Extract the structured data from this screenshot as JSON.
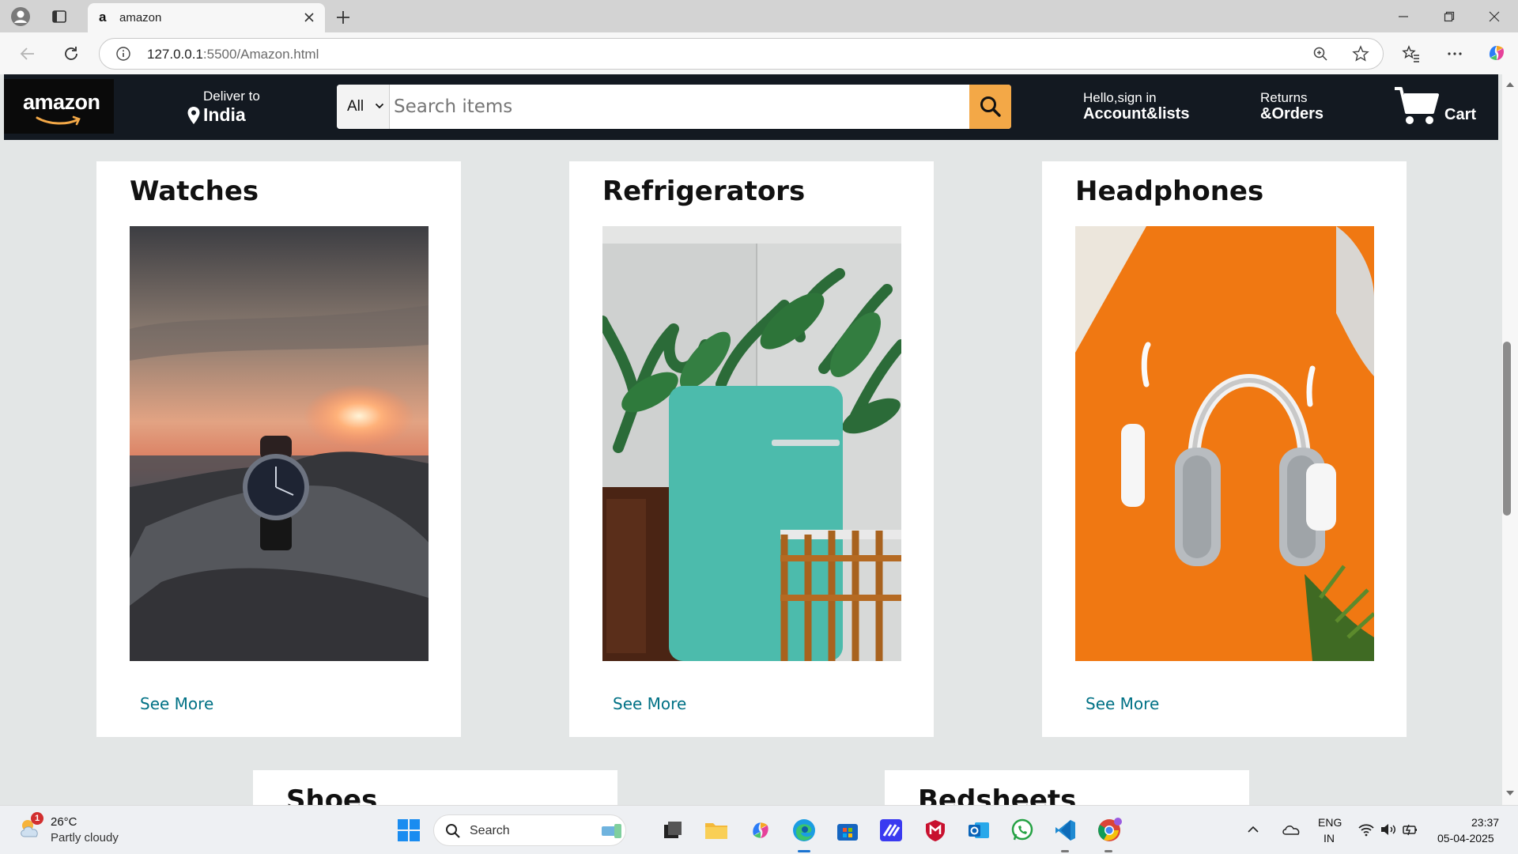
{
  "browser": {
    "tab_title": "amazon",
    "tab_favicon": "a",
    "url_host": "127.0.0.1",
    "url_rest": ":5500/Amazon.html"
  },
  "nav": {
    "logo": "amazon",
    "deliver_line1": "Deliver to",
    "deliver_line2": "India",
    "search_category": "All",
    "search_placeholder": "Search items",
    "account_line1": "Hello,sign in",
    "account_line2": "Account&lists",
    "returns_line1": "Returns",
    "returns_line2": "&Orders",
    "cart_label": "Cart"
  },
  "products": [
    {
      "title": "Watches",
      "link": "See More"
    },
    {
      "title": "Refrigerators",
      "link": "See More"
    },
    {
      "title": "Headphones",
      "link": "See More"
    },
    {
      "title": "Shoes"
    },
    {
      "title": "Bedsheets"
    }
  ],
  "taskbar": {
    "weather_temp": "26°C",
    "weather_desc": "Partly cloudy",
    "weather_badge": "1",
    "search_label": "Search",
    "lang_line1": "ENG",
    "lang_line2": "IN",
    "time": "23:37",
    "date": "05-04-2025"
  },
  "colors": {
    "nav_bg": "#131921",
    "search_button": "#f3a847",
    "link": "#007185",
    "page_bg": "#e3e6e6"
  }
}
